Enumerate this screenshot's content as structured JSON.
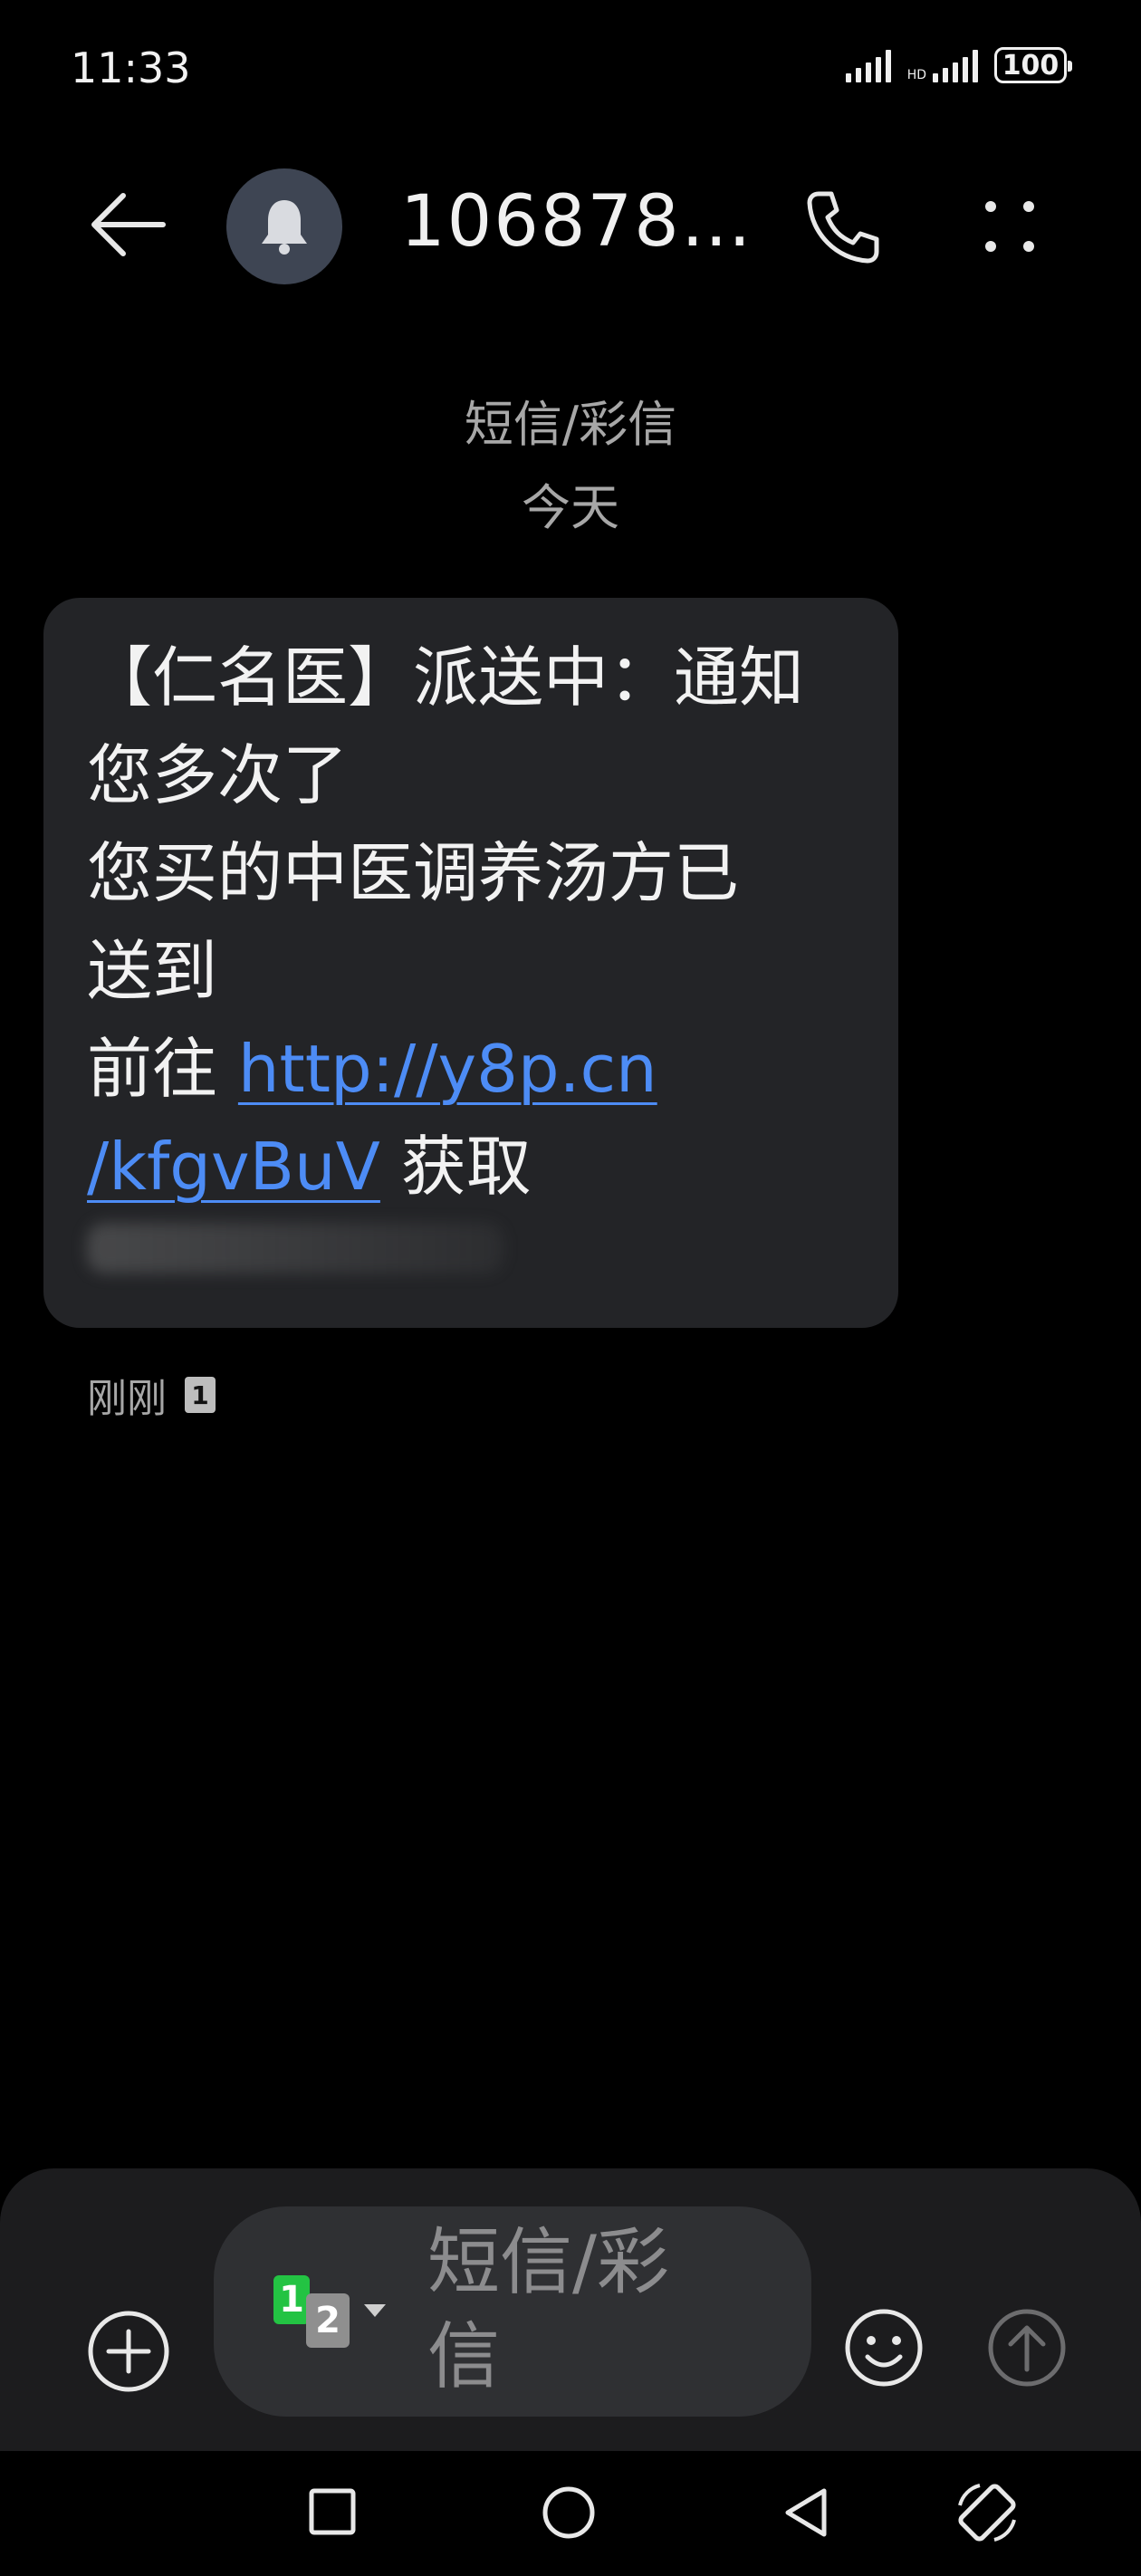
{
  "status_bar": {
    "time": "11:33",
    "battery": "100",
    "signal_2_tag": "HD"
  },
  "header": {
    "contact_name": "106878…",
    "icons": [
      "back-arrow-icon",
      "bell-icon",
      "phone-icon",
      "more-vertical-icon"
    ]
  },
  "conversation": {
    "message_type": "短信/彩信",
    "date_label": "今天"
  },
  "message": {
    "lines": [
      "【仁名医】派送中：通知",
      "您多次了",
      "您买的中医调养汤方已",
      "送到"
    ],
    "prefix": "前往 ",
    "link_part1": "http://y8p.cn",
    "link_part2": "/kfgvBuV",
    "suffix": " 获取",
    "time": "刚刚",
    "sim": "1"
  },
  "compose": {
    "placeholder": "短信/彩信",
    "sim_primary": "1",
    "sim_secondary": "2"
  },
  "colors": {
    "background": "#000000",
    "bubble": "#232427",
    "link": "#4d8cf5",
    "sim_green": "#23c343"
  }
}
